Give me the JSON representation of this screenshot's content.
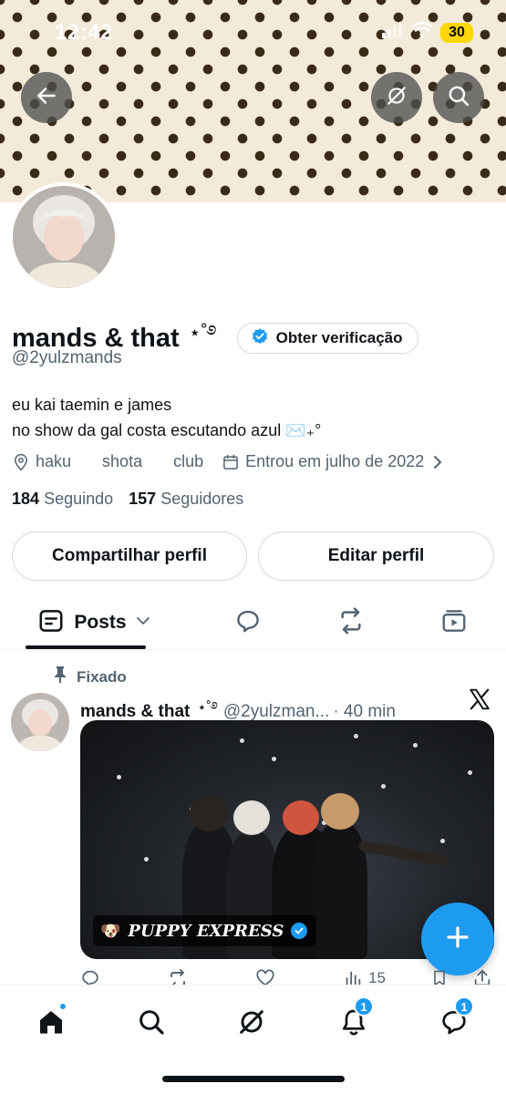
{
  "status_bar": {
    "time": "12:42",
    "battery": "30"
  },
  "profile": {
    "display_name": "mands & that",
    "name_decoration": "⋆˚࿔",
    "verify_button": "Obter verificação",
    "handle": "@2yulzmands",
    "bio_line1": "eu kai taemin e james",
    "bio_line2": "no show da gal costa escutando azul ✉️₊°",
    "location_parts": [
      "haku",
      "shota",
      "club"
    ],
    "joined": "Entrou em julho de 2022",
    "following_count": "184",
    "following_label": "Seguindo",
    "followers_count": "157",
    "followers_label": "Seguidores",
    "share_button": "Compartilhar perfil",
    "edit_button": "Editar perfil"
  },
  "tabs": {
    "posts_label": "Posts"
  },
  "post": {
    "pinned_label": "Fixado",
    "author": "mands & that",
    "author_decoration": "⋆˚࿔",
    "handle": "@2yulzman...",
    "time": "· 40 min",
    "watermark": "PUPPY EXPRESS",
    "views": "15"
  },
  "bottom_nav": {
    "notifications_badge": "1",
    "messages_badge": "1"
  },
  "colors": {
    "accent": "#1d9bf0",
    "text": "#0f1419",
    "muted": "#536471",
    "border": "#cfd9de"
  }
}
